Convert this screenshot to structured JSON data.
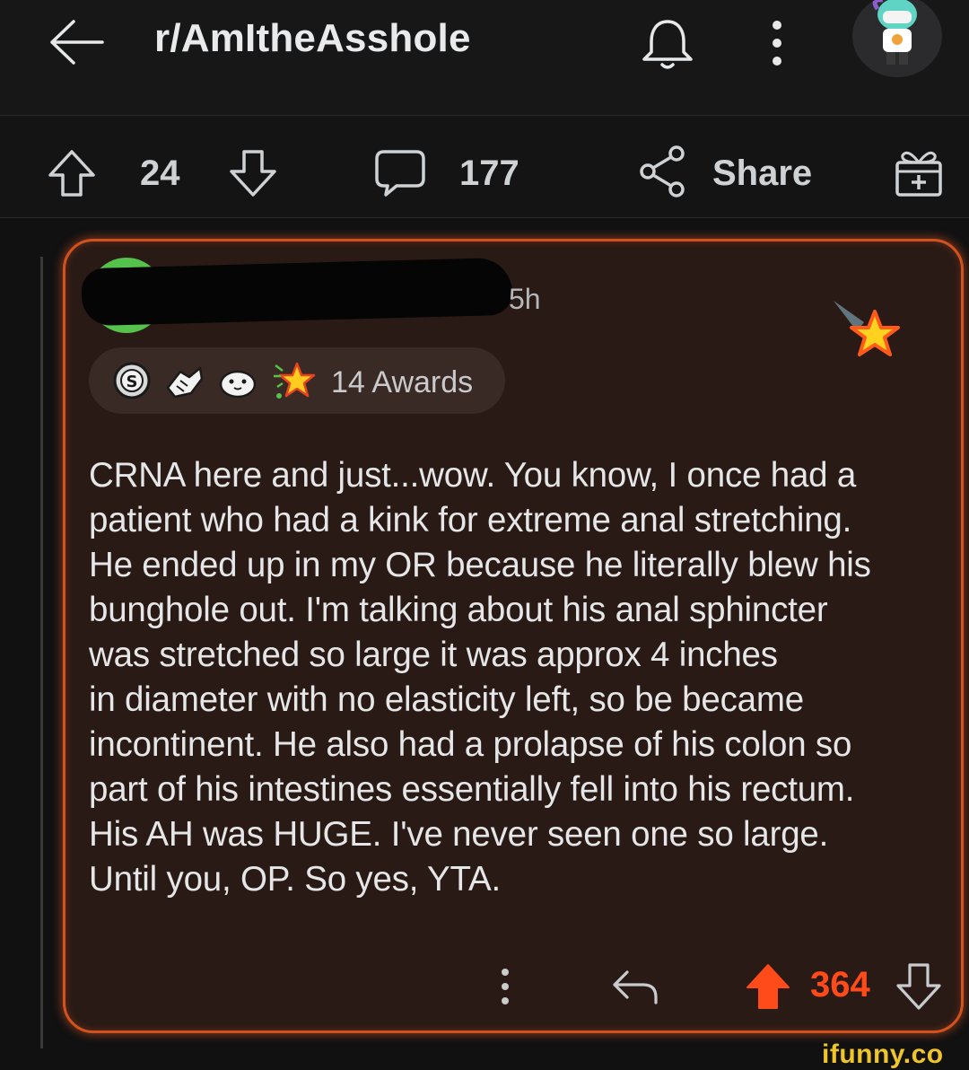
{
  "header": {
    "subreddit": "r/AmItheAsshole",
    "icons": [
      "back-arrow-icon",
      "bell-icon",
      "more-vertical-icon",
      "user-avatar"
    ]
  },
  "post_actions": {
    "upvote_count": "24",
    "comment_count": "177",
    "share_label": "Share"
  },
  "comment": {
    "time_suffix": "5h",
    "awards_label": "14 Awards",
    "award_icons": [
      "silver-coin-award-icon",
      "handshake-award-icon",
      "seal-award-icon",
      "starstruck-award-icon"
    ],
    "body": "CRNA here and just...wow. You know, I once had a\npatient who had a kink for extreme anal stretching.\nHe ended up in my OR because he literally blew his\nbunghole out. I'm talking about his anal sphincter\nwas stretched so large it was approx 4 inches\nin diameter with no elasticity left, so be became\nincontinent. He also had a prolapse of his colon so\npart of his intestines essentially fell into his rectum.\nHis AH was HUGE. I've never seen one so large.\nUntil you, OP. So yes, YTA.",
    "score": "364"
  },
  "watermark": "ifunny.co",
  "colors": {
    "accent": "#ff4a1a",
    "comment_border": "#d2521f",
    "comment_bg": "#2a1a15",
    "background": "#111112"
  }
}
